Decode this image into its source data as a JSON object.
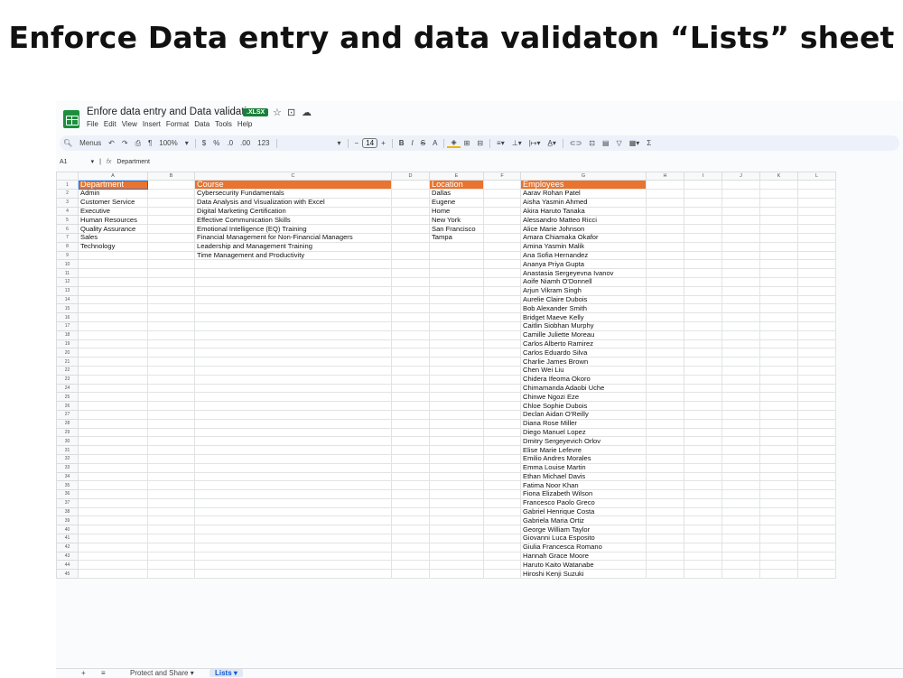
{
  "headline": "Enforce Data entry and data validaton “Lists” sheet",
  "app": {
    "doc_title": "Enfore data entry and Data validation",
    "format_badge": ".XLSX",
    "menus": [
      "File",
      "Edit",
      "View",
      "Insert",
      "Format",
      "Data",
      "Tools",
      "Help"
    ],
    "toolbar": {
      "menus_label": "Menus",
      "zoom": "100%",
      "currency": "$",
      "percent": "%",
      "dec_decrease": ".0",
      "dec_increase": ".00",
      "number_format": "123",
      "font_minus": "−",
      "font_size": "14",
      "font_plus": "+",
      "bold": "B",
      "italic": "I",
      "strike": "S",
      "text_color": "A"
    },
    "formula_bar": {
      "cell_ref": "A1",
      "fx": "fx",
      "content": "Department"
    },
    "columns": [
      "A",
      "B",
      "C",
      "D",
      "E",
      "F",
      "G",
      "H",
      "I",
      "J",
      "K",
      "L"
    ],
    "row_numbers": [
      "1",
      "2",
      "3",
      "4",
      "5",
      "6",
      "7",
      "8",
      "9",
      "10",
      "11",
      "12",
      "13",
      "14",
      "15",
      "16",
      "17",
      "18",
      "19",
      "20",
      "21",
      "22",
      "23",
      "24",
      "25",
      "26",
      "27",
      "28",
      "29",
      "30",
      "31",
      "32",
      "33",
      "34",
      "35",
      "36",
      "37",
      "38",
      "39",
      "40",
      "41",
      "42",
      "43",
      "44",
      "45"
    ],
    "sheet": {
      "department_header": "Department",
      "departments": [
        "Admin",
        "Customer Service",
        "Executive",
        "Human Resources",
        "Quality Assurance",
        "Sales",
        "Technology"
      ],
      "course_header": "Course",
      "courses": [
        "Cybersecurity Fundamentals",
        "Data Analysis and Visualization with Excel",
        "Digital Marketing Certification",
        "Effective Communication Skills",
        "Emotional Intelligence (EQ) Training",
        "Financial Management for Non-Financial Managers",
        "Leadership and Management Training",
        "Time Management and Productivity"
      ],
      "location_header": "Location",
      "locations": [
        "Dallas",
        "Eugene",
        "Home",
        "New York",
        "San Francisco",
        "Tampa"
      ],
      "employees_header": "Employees",
      "employees": [
        "Aarav Rohan Patel",
        "Aisha Yasmin Ahmed",
        "Akira Haruto Tanaka",
        "Alessandro Matteo Ricci",
        "Alice Marie Johnson",
        "Amara Chiamaka Okafor",
        "Amina Yasmin Malik",
        "Ana Sofia Hernandez",
        "Ananya Priya Gupta",
        "Anastasia Sergeyevna Ivanov",
        "Aoife Niamh O'Donnell",
        "Arjun Vikram Singh",
        "Aurelie Claire Dubois",
        "Bob Alexander Smith",
        "Bridget Maeve Kelly",
        "Caitlin Siobhan Murphy",
        "Camille Juliette Moreau",
        "Carlos Alberto Ramirez",
        "Carlos Eduardo Silva",
        "Charlie James Brown",
        "Chen Wei Liu",
        "Chidera Ifeoma Okoro",
        "Chimamanda Adaobi Uche",
        "Chinwe Ngozi Eze",
        "Chloe Sophie Dubois",
        "Declan Aidan O'Reilly",
        "Diana Rose Miller",
        "Diego Manuel Lopez",
        "Dmitry Sergeyevich Orlov",
        "Elise Marie Lefevre",
        "Emilio Andres Morales",
        "Emma Louise Martin",
        "Ethan Michael Davis",
        "Fatima Noor Khan",
        "Fiona Elizabeth Wilson",
        "Francesco Paolo Greco",
        "Gabriel Henrique Costa",
        "Gabriela Maria Ortiz",
        "George William Taylor",
        "Giovanni Luca Esposito",
        "Giulia Francesca Romano",
        "Hannah Grace Moore",
        "Haruto Kaito Watanabe",
        "Hiroshi Kenji Suzuki"
      ]
    },
    "tabs": {
      "add": "+",
      "all_sheets": "≡",
      "sheet1": "Protect and Share ▾",
      "sheet2": "Lists ▾"
    },
    "colors": {
      "header_fill": "#e8742f",
      "sheets_green": "#1e8e3e",
      "selection": "#1a73e8"
    }
  }
}
